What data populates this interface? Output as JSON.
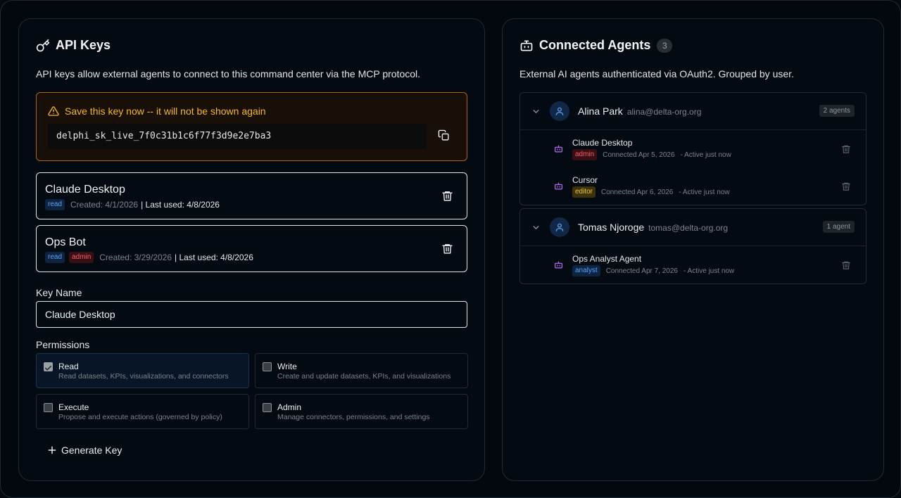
{
  "api_keys": {
    "title": "API Keys",
    "description": "API keys allow external agents to connect to this command center via the MCP protocol.",
    "warning": "Save this key now -- it will not be shown again",
    "new_key": "delphi_sk_live_7f0c31b1c6f77f3d9e2e7ba3",
    "keys": [
      {
        "name": "Claude Desktop",
        "tags": [
          "read"
        ],
        "created": "Created: 4/1/2026",
        "last_used": "| Last used: 4/8/2026"
      },
      {
        "name": "Ops Bot",
        "tags": [
          "read",
          "admin"
        ],
        "created": "Created: 3/29/2026",
        "last_used": "| Last used: 4/8/2026"
      }
    ],
    "key_name_label": "Key Name",
    "key_name_value": "Claude Desktop",
    "permissions_label": "Permissions",
    "permissions": [
      {
        "title": "Read",
        "desc": "Read datasets, KPIs, visualizations, and connectors",
        "checked": true
      },
      {
        "title": "Write",
        "desc": "Create and update datasets, KPIs, and visualizations",
        "checked": false
      },
      {
        "title": "Execute",
        "desc": "Propose and execute actions (governed by policy)",
        "checked": false
      },
      {
        "title": "Admin",
        "desc": "Manage connectors, permissions, and settings",
        "checked": false
      }
    ],
    "generate_label": "Generate Key"
  },
  "agents": {
    "title": "Connected Agents",
    "count": "3",
    "description": "External AI agents authenticated via OAuth2. Grouped by user.",
    "groups": [
      {
        "user": "Alina Park",
        "email": "alina@delta-org.org",
        "count": "2 agents",
        "agents": [
          {
            "name": "Claude Desktop",
            "tag": "admin",
            "connected": "Connected Apr 5, 2026",
            "active": "- Active just now"
          },
          {
            "name": "Cursor",
            "tag": "editor",
            "connected": "Connected Apr 6, 2026",
            "active": "- Active just now"
          }
        ]
      },
      {
        "user": "Tomas Njoroge",
        "email": "tomas@delta-org.org",
        "count": "1 agent",
        "agents": [
          {
            "name": "Ops Analyst Agent",
            "tag": "analyst",
            "connected": "Connected Apr 7, 2026",
            "active": "- Active just now"
          }
        ]
      }
    ]
  },
  "colors": {
    "accent_warning": "#f5b91b",
    "tag_read": "#5ea0ef",
    "tag_admin": "#f0616d",
    "tag_editor": "#e9c53c",
    "agent_icon": "#b36cf0"
  }
}
